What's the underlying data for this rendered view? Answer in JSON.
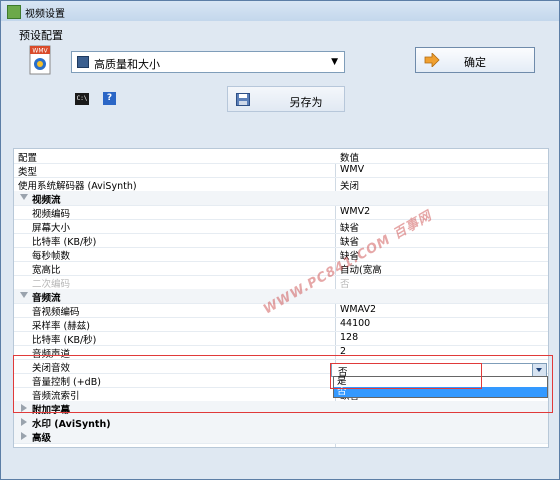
{
  "window": {
    "title": "视频设置"
  },
  "preset": {
    "label": "预设配置",
    "icon": "wmv-file-icon",
    "icon_text": "WMV",
    "selected": "高质量和大小"
  },
  "buttons": {
    "ok": "确定",
    "save_as": "另存为"
  },
  "toolbar": {
    "cmd_icon_text": "C:\\",
    "help_icon_text": "?"
  },
  "grid": {
    "header": {
      "name": "配置",
      "value": "数值"
    },
    "rows": [
      {
        "kind": "prop",
        "name": "类型",
        "value": "WMV"
      },
      {
        "kind": "prop",
        "name": "使用系统解码器 (AviSynth)",
        "value": "关闭"
      },
      {
        "kind": "section",
        "name": "视频流",
        "expanded": true
      },
      {
        "kind": "child",
        "name": "视频编码",
        "value": "WMV2"
      },
      {
        "kind": "child",
        "name": "屏幕大小",
        "value": "缺省"
      },
      {
        "kind": "child",
        "name": "比特率 (KB/秒)",
        "value": "缺省"
      },
      {
        "kind": "child",
        "name": "每秒帧数",
        "value": "缺省"
      },
      {
        "kind": "child",
        "name": "宽高比",
        "value": "自动(宽高"
      },
      {
        "kind": "child-disabled",
        "name": "二次编码",
        "value": "否"
      },
      {
        "kind": "section",
        "name": "音频流",
        "expanded": true
      },
      {
        "kind": "child",
        "name": "音视频编码",
        "value": "WMAV2"
      },
      {
        "kind": "child",
        "name": "采样率 (赫兹)",
        "value": "44100"
      },
      {
        "kind": "child",
        "name": "比特率 (KB/秒)",
        "value": "128"
      },
      {
        "kind": "child",
        "name": "音频声道",
        "value": "2"
      },
      {
        "kind": "child",
        "name": "关闭音效",
        "value": "否"
      },
      {
        "kind": "child",
        "name": "音量控制 (+dB)",
        "value": ""
      },
      {
        "kind": "child",
        "name": "音频流索引",
        "value": "缺省"
      },
      {
        "kind": "section",
        "name": "附加字幕",
        "expanded": false
      },
      {
        "kind": "section",
        "name": "水印 (AviSynth)",
        "expanded": false
      },
      {
        "kind": "section",
        "name": "高级",
        "expanded": false
      }
    ]
  },
  "dropdown": {
    "current": "否",
    "options": [
      "是",
      "否"
    ],
    "highlighted_index": 1
  },
  "watermark": "WWW.PC841.COM 百事网",
  "colors": {
    "highlight_red": "#e03a3a",
    "selection_blue": "#3399ff"
  }
}
